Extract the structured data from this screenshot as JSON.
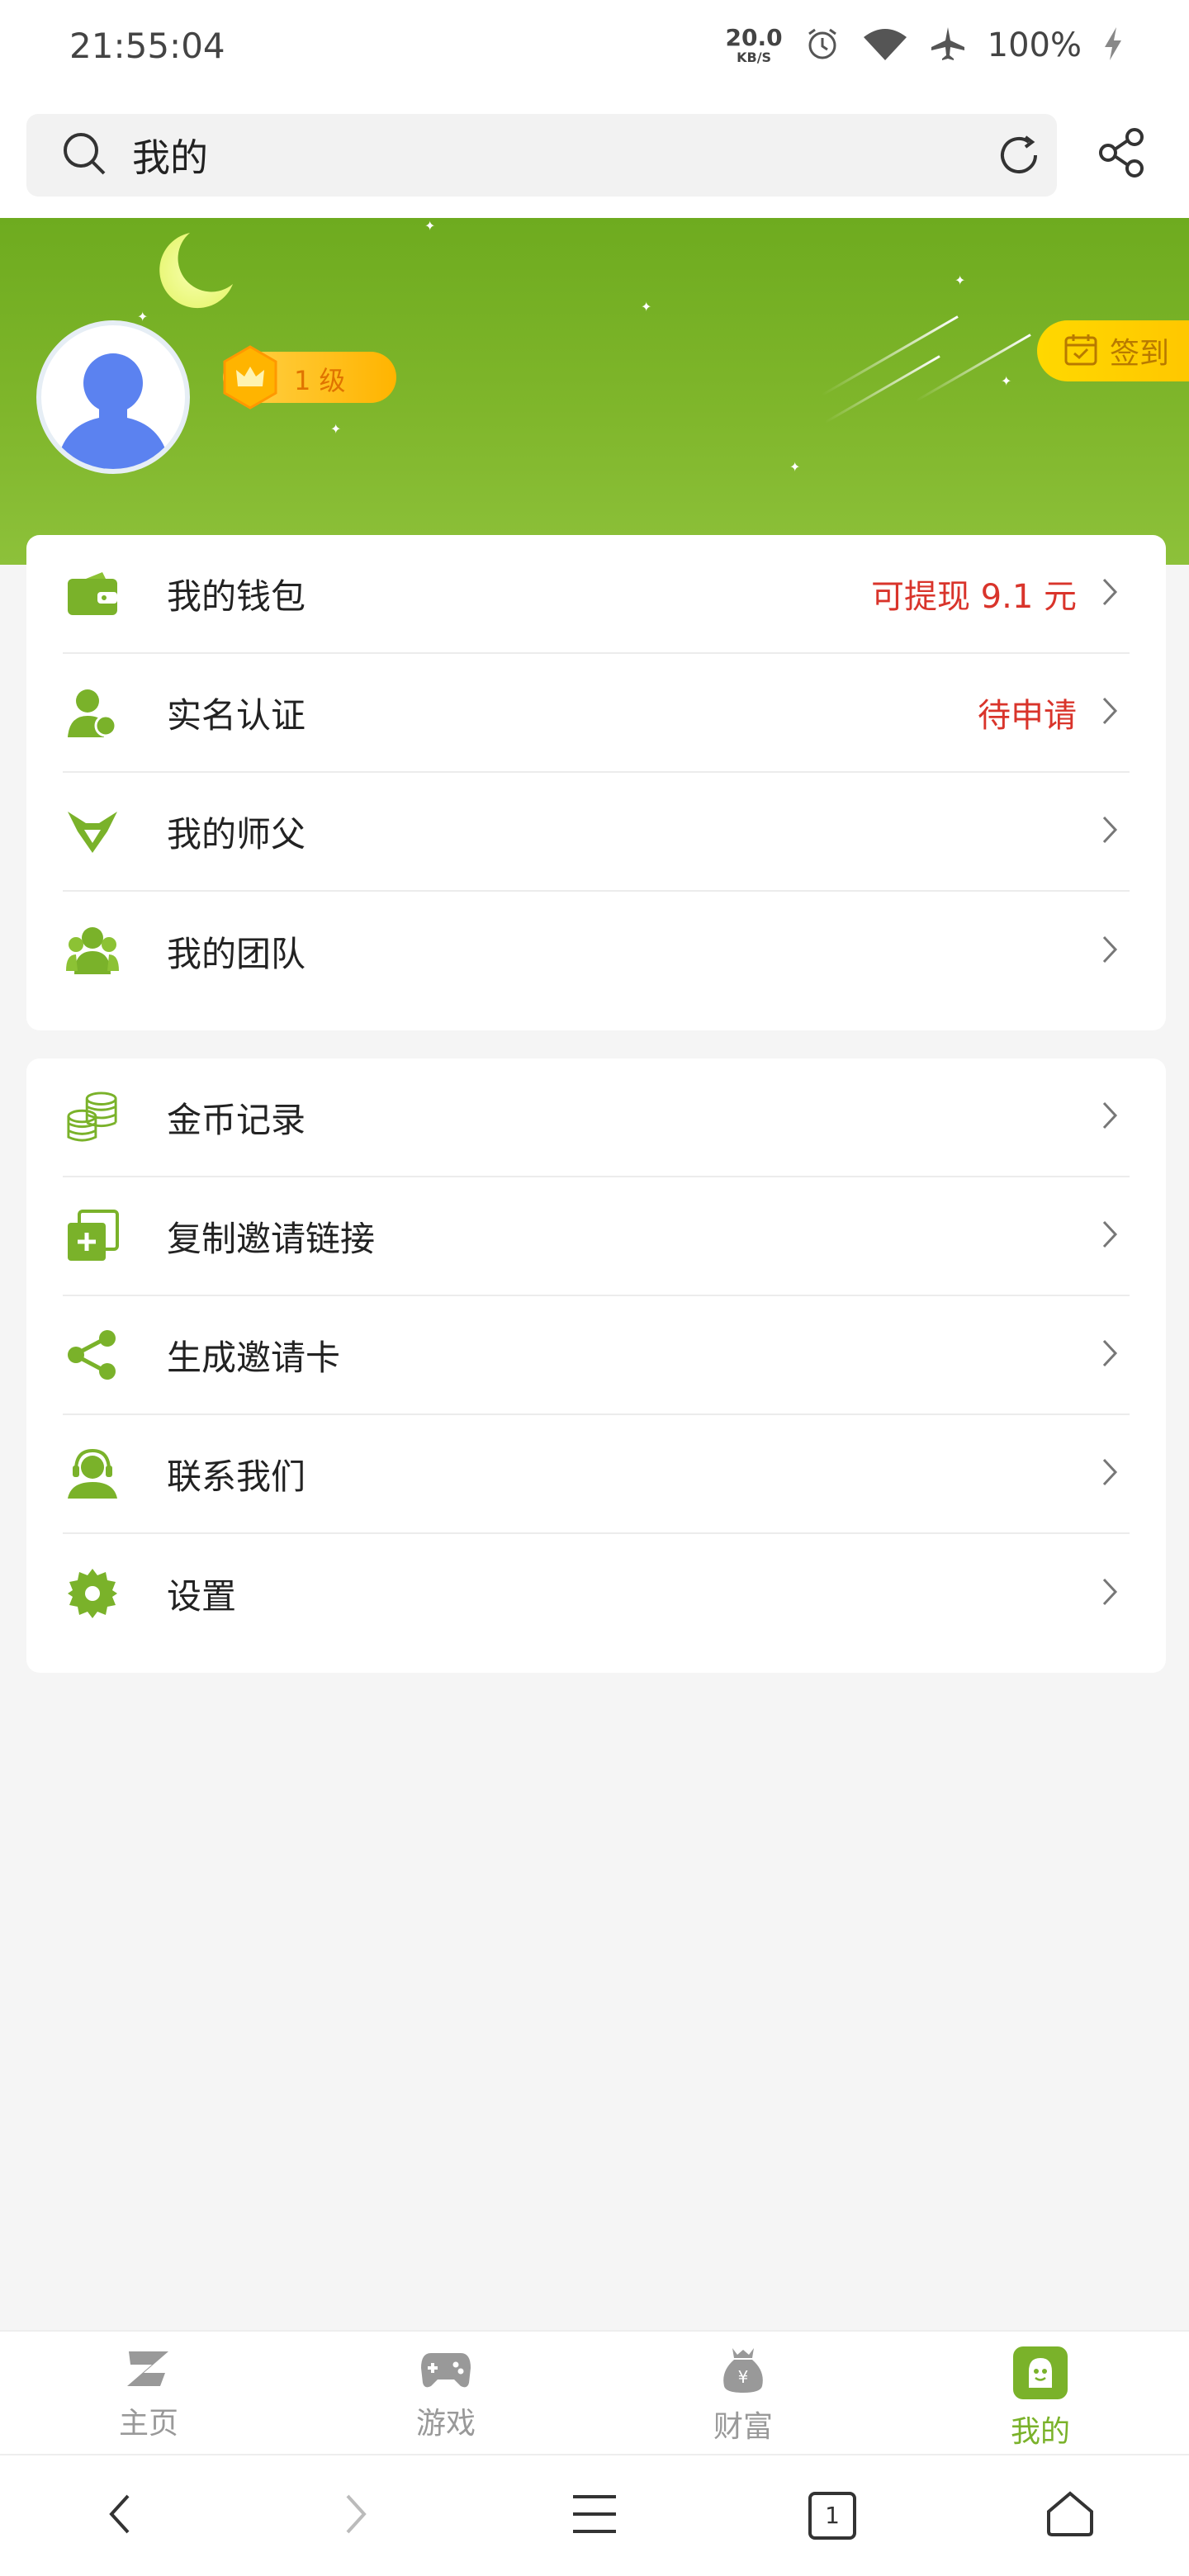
{
  "status": {
    "time": "21:55:04",
    "net_speed": "20.0",
    "net_unit": "KB/S",
    "battery": "100%"
  },
  "search": {
    "value": "我的"
  },
  "profile": {
    "level": "1 级",
    "checkin_label": "签到"
  },
  "menu_group_1": [
    {
      "label": "我的钱包",
      "extra": "可提现 9.1 元",
      "icon": "wallet-icon"
    },
    {
      "label": "实名认证",
      "extra": "待申请",
      "icon": "user-verify-icon"
    },
    {
      "label": "我的师父",
      "extra": "",
      "icon": "mentor-icon"
    },
    {
      "label": "我的团队",
      "extra": "",
      "icon": "team-icon"
    }
  ],
  "menu_group_2": [
    {
      "label": "金币记录",
      "icon": "coins-icon"
    },
    {
      "label": "复制邀请链接",
      "icon": "copy-link-icon"
    },
    {
      "label": "生成邀请卡",
      "icon": "share-icon"
    },
    {
      "label": "联系我们",
      "icon": "support-icon"
    },
    {
      "label": "设置",
      "icon": "settings-icon"
    }
  ],
  "bottom_nav": [
    {
      "label": "主页",
      "icon": "home-z-icon"
    },
    {
      "label": "游戏",
      "icon": "gamepad-icon"
    },
    {
      "label": "财富",
      "icon": "money-bag-icon"
    },
    {
      "label": "我的",
      "icon": "me-icon",
      "active": true
    }
  ],
  "browser_nav": {
    "tab_count": "1"
  },
  "colors": {
    "brand_green": "#7ab22a",
    "alert_red": "#d9342b",
    "gold": "#ffc400"
  }
}
